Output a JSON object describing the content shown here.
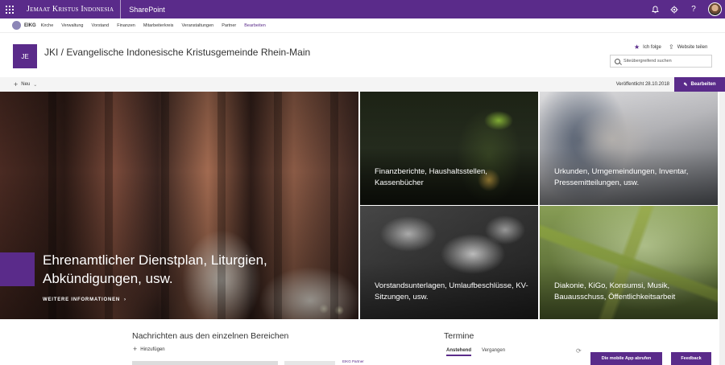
{
  "suite": {
    "brand": "Jemaat Kristus Indonesia",
    "app": "SharePoint",
    "icons": [
      "bell-icon",
      "gear-icon",
      "help-icon"
    ],
    "help_glyph": "?"
  },
  "nav": {
    "site_short": "EIKG",
    "items": [
      "Kirche",
      "Verwaltung",
      "Vorstand",
      "Finanzen",
      "Mitarbeiterkreis",
      "Veranstaltungen",
      "Partner"
    ],
    "edit_label": "Bearbeiten"
  },
  "header": {
    "logo_text": "JE",
    "title": "JKI / Evangelische Indonesische Kristusgemeinde Rhein-Main",
    "follow_label": "Ich folge",
    "share_label": "Website teilen",
    "search_placeholder": "Siteübergreifend suchen"
  },
  "command": {
    "new_label": "Neu",
    "published": "Veröffentlicht 28.10.2018",
    "edit_button": "Bearbeiten"
  },
  "hero": {
    "main": {
      "title": "Ehrenamtlicher Dienstplan, Liturgien, Abkündigungen, usw.",
      "more": "WEITERE INFORMATIONEN"
    },
    "tiles": [
      {
        "text": "Finanzberichte, Haushaltsstellen, Kassenbücher"
      },
      {
        "text": "Urkunden, Urngemeindungen, Inventar, Pressemitteilungen, usw."
      },
      {
        "text": "Vorstandsunterlagen, Umlaufbeschlüsse, KV-Sitzungen, usw."
      },
      {
        "text": "Diakonie, KiGo, Konsumsi, Musik, Bauausschuss, Öffentlichkeitsarbeit"
      }
    ]
  },
  "news": {
    "title": "Nachrichten aus den einzelnen Bereichen",
    "add_label": "Hinzufügen",
    "partner_label": "EIKG Partner"
  },
  "events": {
    "title": "Termine",
    "tab_upcoming": "Anstehend",
    "tab_past": "Vergangen"
  },
  "footer_buttons": {
    "mobile_app": "Die mobile App abrufen",
    "feedback": "Feedback"
  },
  "colors": {
    "accent": "#5a2b8a"
  }
}
